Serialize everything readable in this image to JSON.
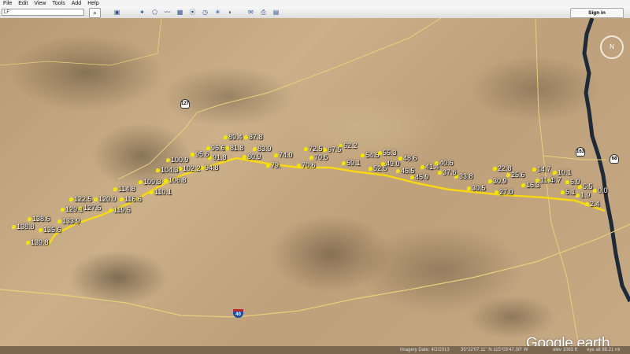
{
  "menu": {
    "file": "File",
    "edit": "Edit",
    "view": "View",
    "tools": "Tools",
    "add": "Add",
    "help": "Help"
  },
  "search": {
    "value": "LF"
  },
  "toolbar": {
    "signin_label": "Sign in"
  },
  "map": {
    "markers": [
      "0.0",
      "1.9",
      "2.4",
      "5.1",
      "5.5",
      "6.9",
      "8.7",
      "10.1",
      "11.4",
      "14.7",
      "16.3",
      "22.8",
      "25.6",
      "27.0",
      "30.5",
      "30.9",
      "33.8",
      "37.6",
      "40.6",
      "41.4",
      "45.9",
      "46.5",
      "48.6",
      "49.0",
      "52.5",
      "54.5",
      "55.3",
      "59.1",
      "62.2",
      "67.5",
      "70.5",
      "70.6",
      "72.5",
      "74.0",
      "79.",
      "80.9",
      "81.8",
      "83.9",
      "87.8",
      "89.4",
      "91.8",
      "94.8",
      "95.6",
      "96.6",
      "100.9",
      "102.2",
      "104.3",
      "106.8",
      "109.3",
      "110.1",
      "114.8",
      "116.6",
      "119.5",
      "120.0",
      "122.5",
      "127.5",
      "129.1",
      "133.9",
      "135.6",
      "138.6",
      "138.8",
      "139.8"
    ],
    "shields": [
      "127",
      "163",
      "68",
      "40"
    ],
    "place_label": "",
    "compass": "N"
  },
  "logo": {
    "google": "Google",
    "earth": "earth"
  },
  "status": {
    "imagery": "Imagery Date: 4/2/2013",
    "coords": "35°22'07.11\" N  115°03'47.30\" W",
    "elev": "elev 1083 ft",
    "eye": "eye alt 88.21 mi"
  },
  "colors": {
    "route": "#ffe100",
    "road": "#e8d07a",
    "river": "#1d2a3a"
  }
}
